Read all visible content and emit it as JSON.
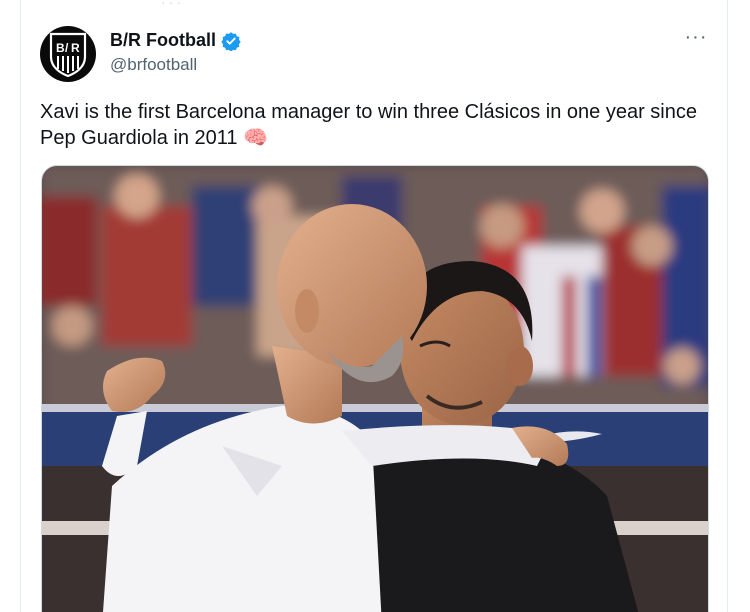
{
  "tweet": {
    "author": {
      "display_name": "B/R Football",
      "handle": "@brfootball",
      "avatar_icon": "br-shield-logo",
      "verified_icon": "verified-badge-icon",
      "verified_color": "#1d9bf0"
    },
    "text": "Xavi is the first Barcelona manager to win three Clásicos in one year since Pep Guardiola in 2011 🧠",
    "more_icon": "more-options-icon",
    "more_label": "···",
    "media": {
      "icon": "photo-two-managers-embracing"
    }
  },
  "colors": {
    "text_primary": "#0f1419",
    "text_secondary": "#536471",
    "border": "#cfd9de"
  }
}
